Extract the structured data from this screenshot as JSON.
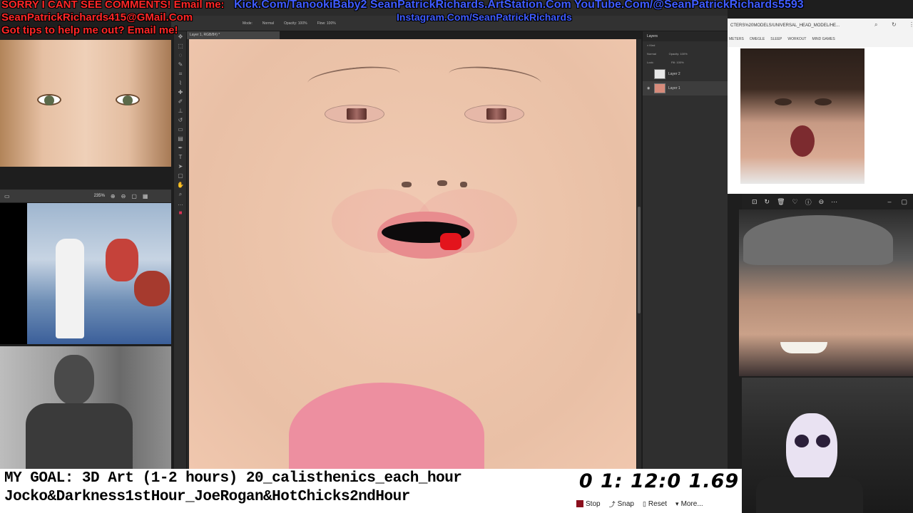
{
  "overlay": {
    "line1_red": "SORRY I CANT SEE COMMENTS! Email me:",
    "line1_blue": "Kick.Com/TanookiBaby2 SeanPatrickRichards.ArtStation.Com YouTube.Com/@SeanPatrickRichards5593",
    "line2_red": "SeanPatrickRichards415@GMail.Com",
    "line2_blue": "Instagram.Com/SeanPatrickRichards",
    "line3_red": "Got tips to help me out? Email me!"
  },
  "photoshop": {
    "doc_tab": "Layer 1, RGB/8#) *",
    "options": [
      "Mode:",
      "Normal",
      "Opacity: 100%",
      "Flow: 100%"
    ],
    "zoom": "235%",
    "layers_panel_title": "Layers",
    "kind_label": "Kind",
    "blend_mode": "Normal",
    "opacity_label": "Opacity: 100%",
    "fill_label": "Fill: 100%",
    "lock_label": "Lock:",
    "layers": [
      {
        "name": "Layer 2",
        "color": "#e8e8e8"
      },
      {
        "name": "Layer 1",
        "color": "#d78b7b"
      }
    ]
  },
  "browser": {
    "url": "CTERS%20MODELS/UNIVERSAL_HEAD_MODEL/HE...",
    "bookmarks": [
      "METERS",
      "OMEGLE",
      "SLEEP",
      "WORKOUT",
      "MIND GAMES"
    ]
  },
  "goal": {
    "line1": "MY GOAL: 3D Art (1-2 hours) 20_calisthenics_each_hour",
    "line2": "Jocko&Darkness1stHour_JoeRogan&HotChicks2ndHour"
  },
  "timer": {
    "display": "0 1: 12:0 1.69",
    "buttons": [
      "Stop",
      "Snap",
      "Reset",
      "More..."
    ]
  },
  "colors": {
    "overlay_red": "#ff2727",
    "overlay_blue": "#3f5cff",
    "stop_button": "#8a0f1d"
  }
}
